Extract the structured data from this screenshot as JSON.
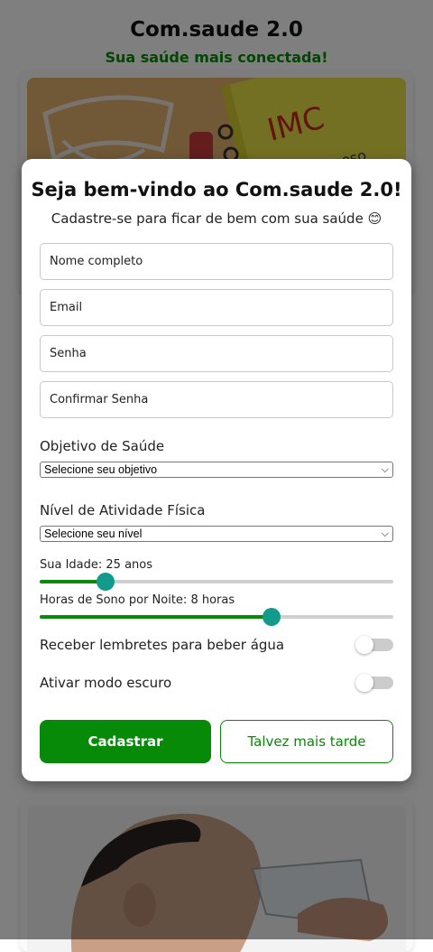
{
  "app": {
    "title": "Com.saude 2.0",
    "tagline": "Sua saúde mais conectada!"
  },
  "background_cards": [
    {
      "image_text": "IMC",
      "image_subtext": "peso"
    },
    {
      "image_text": ""
    }
  ],
  "modal": {
    "title": "Seja bem-vindo ao Com.saude 2.0!",
    "subtitle": "Cadastre-se para ficar de bem com sua saúde 😊",
    "fields": {
      "name_placeholder": "Nome completo",
      "email_placeholder": "Email",
      "password_placeholder": "Senha",
      "confirm_placeholder": "Confirmar Senha"
    },
    "goal": {
      "label": "Objetivo de Saúde",
      "selected": "Selecione seu objetivo"
    },
    "activity": {
      "label": "Nível de Atividade Física",
      "selected": "Selecione seu nível"
    },
    "age": {
      "label": "Sua Idade: 25 anos",
      "value": 25,
      "level": 0.185
    },
    "sleep": {
      "label": "Horas de Sono por Noite: 8 horas",
      "value": 8,
      "level": 0.655
    },
    "water_reminder": {
      "label": "Receber lembretes para beber água",
      "on": false
    },
    "dark_mode": {
      "label": "Ativar modo escuro",
      "on": false
    },
    "buttons": {
      "register": "Cadastrar",
      "later": "Talvez mais tarde"
    }
  },
  "colors": {
    "brand_green": "#078a07",
    "slider_thumb": "#129a8a",
    "overlay": "rgba(0,0,0,0.5)"
  },
  "icons": [
    "smile-emoji-icon",
    "chevron-down-icon"
  ]
}
